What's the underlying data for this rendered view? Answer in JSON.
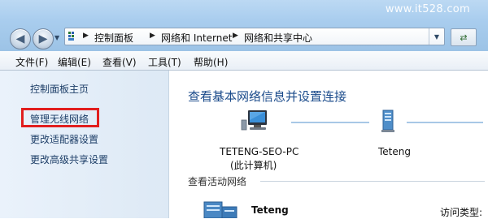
{
  "watermark": "www.it528.com",
  "address_bar": {
    "crumbs": [
      "控制面板",
      "网络和 Internet",
      "网络和共享中心"
    ]
  },
  "menu": [
    "文件(F)",
    "编辑(E)",
    "查看(V)",
    "工具(T)",
    "帮助(H)"
  ],
  "sidebar": {
    "items": [
      {
        "label": "控制面板主页"
      },
      {
        "label": "管理无线网络",
        "highlighted": true
      },
      {
        "label": "更改适配器设置"
      },
      {
        "label": "更改高级共享设置"
      }
    ]
  },
  "main": {
    "heading": "查看基本网络信息并设置连接",
    "computer": {
      "name": "TETENG-SEO-PC",
      "sub": "(此计算机)"
    },
    "network": {
      "name": "Teteng"
    },
    "active_section": "查看活动网络",
    "active_network": {
      "name": "Teteng",
      "access_type_label": "访问类型:"
    }
  },
  "colors": {
    "highlight_border": "#e11e1e",
    "link": "#1e3f68",
    "heading": "#1b4b8b"
  }
}
